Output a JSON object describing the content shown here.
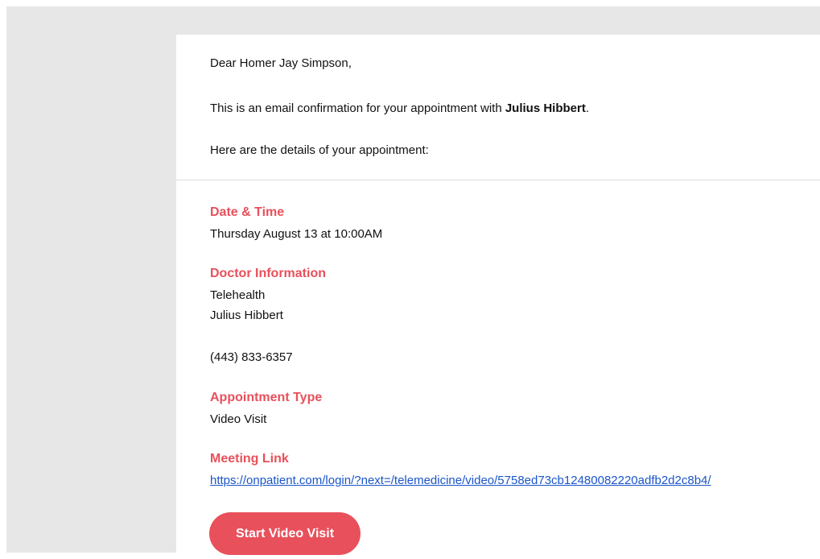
{
  "email": {
    "greeting": "Dear Homer Jay Simpson,",
    "confirmation_prefix": "This is an email confirmation for your appointment with ",
    "doctor_name_bold": "Julius Hibbert",
    "confirmation_suffix": ".",
    "details_intro": "Here are the details of your appointment:"
  },
  "details": {
    "datetime": {
      "label": "Date & Time",
      "value": "Thursday August 13 at 10:00AM"
    },
    "doctor": {
      "label": "Doctor Information",
      "line1": "Telehealth",
      "line2": "Julius Hibbert",
      "phone": "(443) 833-6357"
    },
    "appointment_type": {
      "label": "Appointment Type",
      "value": "Video Visit"
    },
    "meeting_link": {
      "label": "Meeting Link",
      "url": "https://onpatient.com/login/?next=/telemedicine/video/5758ed73cb12480082220adfb2d2c8b4/"
    }
  },
  "button": {
    "label": "Start Video Visit"
  },
  "colors": {
    "accent": "#e8505b",
    "link": "#1a55c9",
    "background_gray": "#e7e7e7"
  }
}
